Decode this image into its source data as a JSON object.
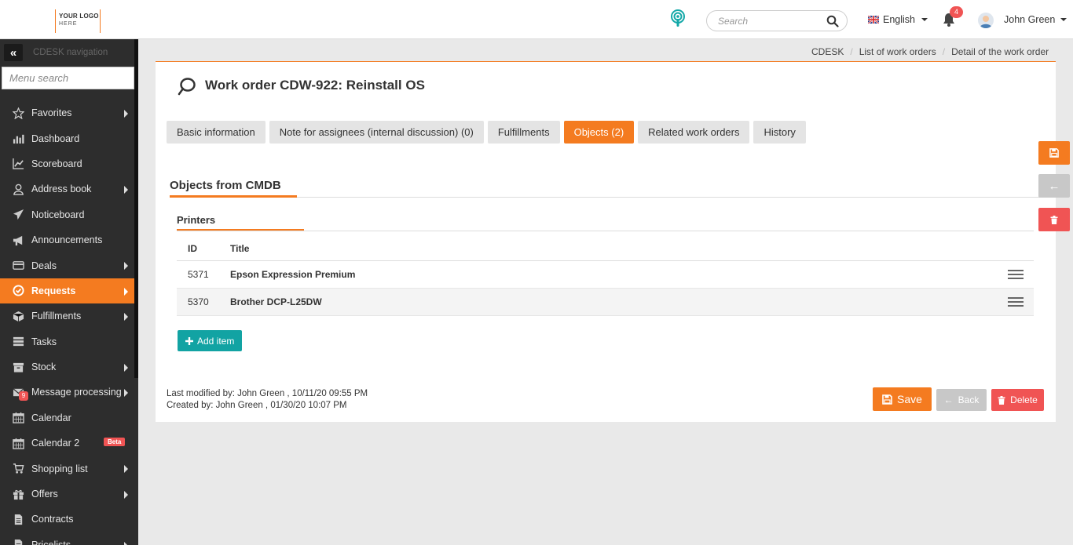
{
  "topbar": {
    "logo_line1_a": "YOUR",
    "logo_line1_b": "LOGO",
    "logo_line2": "HERE",
    "search_placeholder": "Search",
    "language": "English",
    "notifications_count": "4",
    "user_name": "John Green"
  },
  "sidebar": {
    "nav_title": "CDESK navigation",
    "menu_search_placeholder": "Menu search",
    "items": [
      {
        "label": "Favorites",
        "icon": "star-icon",
        "arrow": true
      },
      {
        "label": "Dashboard",
        "icon": "bar-chart-icon",
        "arrow": false
      },
      {
        "label": "Scoreboard",
        "icon": "line-chart-icon",
        "arrow": false
      },
      {
        "label": "Address book",
        "icon": "user-icon",
        "arrow": true
      },
      {
        "label": "Noticeboard",
        "icon": "paper-plane-icon",
        "arrow": false
      },
      {
        "label": "Announcements",
        "icon": "megaphone-icon",
        "arrow": false
      },
      {
        "label": "Deals",
        "icon": "credit-card-icon",
        "arrow": true
      },
      {
        "label": "Requests",
        "icon": "check-circle-icon",
        "arrow": true,
        "active": true
      },
      {
        "label": "Fulfillments",
        "icon": "box-icon",
        "arrow": true
      },
      {
        "label": "Tasks",
        "icon": "tasks-icon",
        "arrow": false
      },
      {
        "label": "Stock",
        "icon": "archive-icon",
        "arrow": true
      },
      {
        "label": "Message processing",
        "icon": "envelope-icon",
        "arrow": true,
        "badge": "9"
      },
      {
        "label": "Calendar",
        "icon": "calendar-icon",
        "arrow": false
      },
      {
        "label": "Calendar 2",
        "icon": "calendar-icon",
        "arrow": false,
        "tag": "Beta"
      },
      {
        "label": "Shopping list",
        "icon": "cart-icon",
        "arrow": true
      },
      {
        "label": "Offers",
        "icon": "gift-icon",
        "arrow": true
      },
      {
        "label": "Contracts",
        "icon": "document-icon",
        "arrow": false
      },
      {
        "label": "Pricelists",
        "icon": "document-icon",
        "arrow": true
      }
    ]
  },
  "breadcrumb": [
    "CDESK",
    "List of work orders",
    "Detail of the work order"
  ],
  "page": {
    "title": "Work order CDW-922: Reinstall OS"
  },
  "tabs": [
    {
      "label": "Basic information",
      "active": false
    },
    {
      "label": "Note for assignees (internal discussion) (0)",
      "active": false
    },
    {
      "label": "Fulfillments",
      "active": false
    },
    {
      "label": "Objects (2)",
      "active": true
    },
    {
      "label": "Related work orders",
      "active": false
    },
    {
      "label": "History",
      "active": false
    }
  ],
  "objects": {
    "section_title": "Objects from CMDB",
    "group_title": "Printers",
    "columns": {
      "id": "ID",
      "title": "Title"
    },
    "rows": [
      {
        "id": "5371",
        "title": "Epson Expression Premium"
      },
      {
        "id": "5370",
        "title": "Brother DCP-L25DW"
      }
    ],
    "add_label": "Add item"
  },
  "meta": {
    "modified": "Last modified by:  John Green , 10/11/20 09:55 PM",
    "created": "Created by:  John Green , 01/30/20 10:07 PM"
  },
  "actions": {
    "save": "Save",
    "back": "Back",
    "delete": "Delete"
  },
  "colors": {
    "accent": "#f47b20",
    "sidebar_bg": "#2d2d2d",
    "add_button": "#12a3a3",
    "delete": "#f05454",
    "back": "#c8c8c8"
  }
}
